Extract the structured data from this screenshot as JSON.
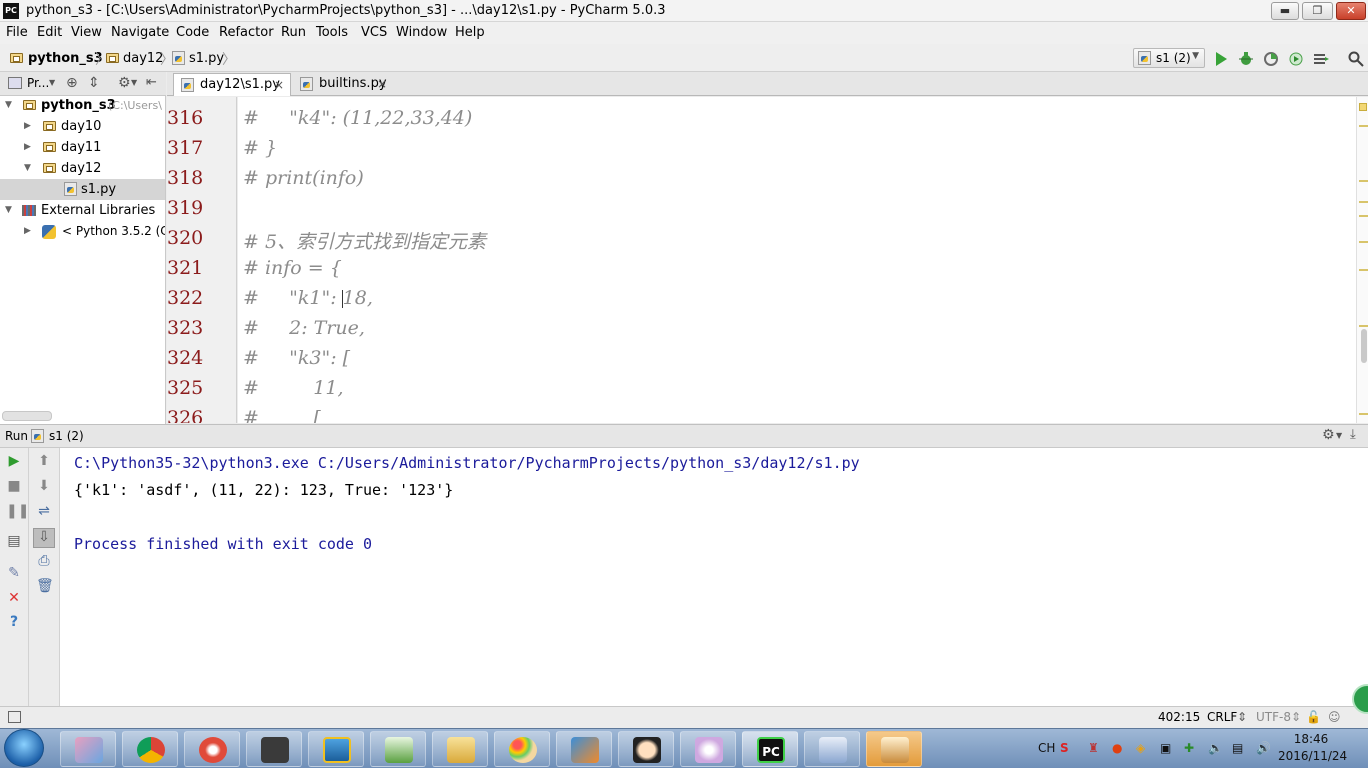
{
  "window": {
    "title": "python_s3 - [C:\\Users\\Administrator\\PycharmProjects\\python_s3] - ...\\day12\\s1.py - PyCharm 5.0.3",
    "app_icon": "PC",
    "min": "▬",
    "max": "❐",
    "close": "✕"
  },
  "menu": [
    "File",
    "Edit",
    "View",
    "Navigate",
    "Code",
    "Refactor",
    "Run",
    "Tools",
    "VCS",
    "Window",
    "Help"
  ],
  "breadcrumb": {
    "project": "python_s3",
    "folder": "day12",
    "file": "s1.py"
  },
  "toolbar": {
    "run_config": "s1 (2)"
  },
  "project_panel": {
    "header": "Pr...",
    "tree": [
      {
        "label": "python_s3",
        "hint": "(C:\\Users\\"
      },
      {
        "label": "day10"
      },
      {
        "label": "day11"
      },
      {
        "label": "day12"
      },
      {
        "label": "s1.py"
      },
      {
        "label": "External Libraries"
      },
      {
        "label": "< Python 3.5.2 (C:\\"
      }
    ]
  },
  "tabs": [
    {
      "label": "day12\\s1.py",
      "close": "×"
    },
    {
      "label": "builtins.py",
      "close": "×"
    }
  ],
  "editor": {
    "lines": [
      {
        "num": "316",
        "text": "#     \"k4\": (11,22,33,44)"
      },
      {
        "num": "317",
        "text": "# }"
      },
      {
        "num": "318",
        "text": "# print(info)"
      },
      {
        "num": "319",
        "text": ""
      },
      {
        "num": "320",
        "text": "# 5、索引方式找到指定元素"
      },
      {
        "num": "321",
        "text": "# info = {"
      },
      {
        "num": "322",
        "text": "#     \"k1\": 18,"
      },
      {
        "num": "323",
        "text": "#     2: True,"
      },
      {
        "num": "324",
        "text": "#     \"k3\": ["
      },
      {
        "num": "325",
        "text": "#         11,"
      },
      {
        "num": "326",
        "text": "#         ["
      }
    ]
  },
  "run_panel": {
    "label": "Run",
    "config": "s1 (2)",
    "console": [
      "C:\\Python35-32\\python3.exe C:/Users/Administrator/PycharmProjects/python_s3/day12/s1.py",
      "{'k1': 'asdf', (11, 22): 123, True: '123'}",
      "",
      "Process finished with exit code 0"
    ]
  },
  "status": {
    "position": "402:15",
    "line_sep": "CRLF",
    "encoding": "UTF-8"
  },
  "taskbar": {
    "ime": "CH",
    "time": "18:46",
    "date": "2016/11/24"
  }
}
